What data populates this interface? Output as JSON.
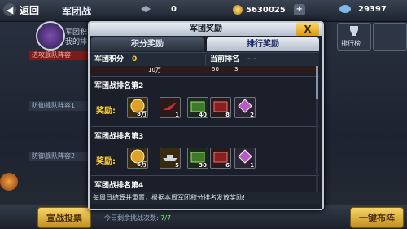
{
  "header": {
    "back_label": "返回",
    "title": "军团战",
    "value_a": "0",
    "coins": "5630025",
    "gems": "29397",
    "plus": "+"
  },
  "background": {
    "legion_points": "军团积",
    "my_rank": "我的排",
    "attack_fleet": "进攻舰队阵容",
    "defense_fleet_1": "防御舰队阵容1",
    "defense_fleet_2": "防御舰队阵容2",
    "ranking_label": "排行榜",
    "declare_button": "宣战投票",
    "today_text": "今日剩余挑战次数:",
    "today_value": "7/7",
    "deploy_button": "一键布阵"
  },
  "modal": {
    "title": "军团奖励",
    "close": "X",
    "tabs": [
      "积分奖励",
      "排行奖励"
    ],
    "active_tab": 1,
    "points_label": "军团积分",
    "points_value": "0",
    "rank_label": "当前排名",
    "rank_value": "- -",
    "rewards_label": "奖励:",
    "partial_qty": [
      "10万",
      "50",
      "3"
    ],
    "ranks": [
      {
        "title": "军团战排名第2",
        "items": [
          {
            "icon": "coin-medal-icon",
            "qty": "8万"
          },
          {
            "icon": "feather-wing-icon",
            "qty": "1"
          },
          {
            "icon": "green-crate-icon",
            "qty": "40"
          },
          {
            "icon": "red-crate-icon",
            "qty": "8"
          },
          {
            "icon": "rank-badge-icon",
            "qty": "2"
          }
        ]
      },
      {
        "title": "军团战排名第3",
        "items": [
          {
            "icon": "coin-medal-icon",
            "qty": "6万"
          },
          {
            "icon": "warship-icon",
            "qty": "5"
          },
          {
            "icon": "green-crate-icon",
            "qty": "30"
          },
          {
            "icon": "red-crate-icon",
            "qty": "6"
          },
          {
            "icon": "rank-badge-icon",
            "qty": "1"
          }
        ]
      },
      {
        "title": "军团战排名第4",
        "items": []
      }
    ],
    "footer": "每周日结算并重置，根据本周军团积分排名发放奖励!"
  },
  "colors": {
    "accent_gold": "#ffcf3a",
    "tab_active": "#1a2a6a"
  }
}
